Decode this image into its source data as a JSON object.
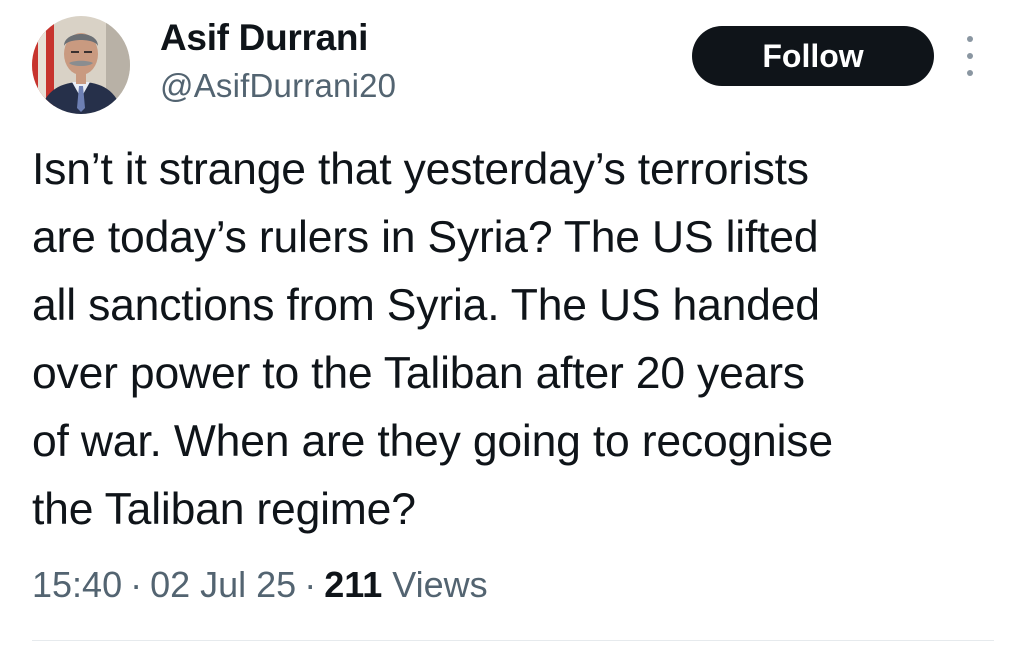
{
  "author": {
    "display_name": "Asif Durrani",
    "handle": "@AsifDurrani20"
  },
  "follow_button": {
    "label": "Follow"
  },
  "tweet": {
    "lines": [
      "Isn’t it strange that yesterday’s terrorists",
      "are today’s rulers in Syria? The US lifted",
      "all sanctions from Syria. The US handed",
      "over power to the Taliban after 20 years",
      "of war. When are they going to recognise",
      "the Taliban regime?"
    ]
  },
  "meta": {
    "time": "15:40",
    "separator": "·",
    "date": "02 Jul 25",
    "views_count": "211",
    "views_label": "Views"
  },
  "icons": {
    "more": "more-vertical-icon",
    "avatar": "profile-photo"
  },
  "colors": {
    "follow_bg": "#0f1419",
    "follow_text": "#ffffff",
    "secondary_text": "#536471"
  }
}
